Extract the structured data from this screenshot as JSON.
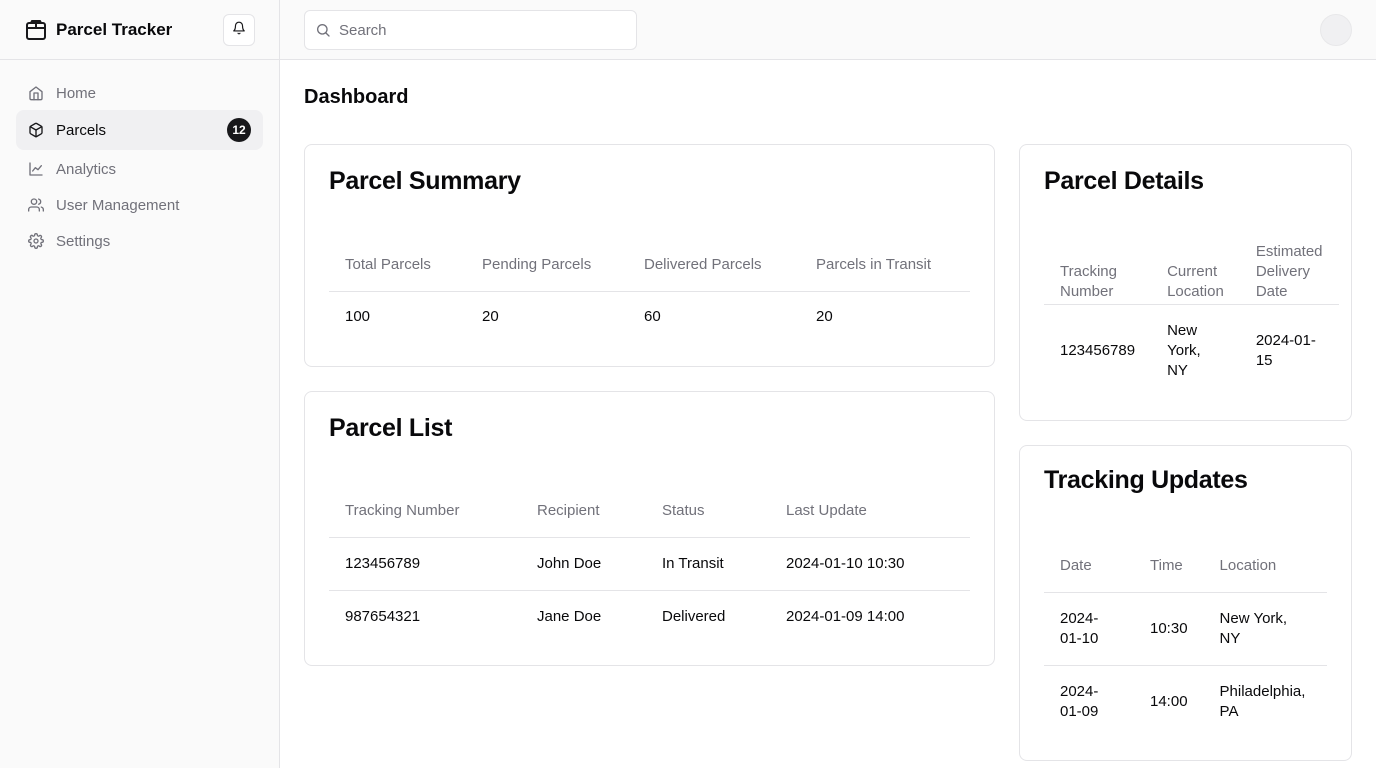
{
  "app": {
    "title": "Parcel Tracker"
  },
  "sidebar": {
    "items": [
      {
        "label": "Home",
        "icon": "home-icon",
        "active": false
      },
      {
        "label": "Parcels",
        "icon": "package-icon",
        "active": true,
        "badge": "12"
      },
      {
        "label": "Analytics",
        "icon": "line-chart-icon",
        "active": false
      },
      {
        "label": "User Management",
        "icon": "users-icon",
        "active": false
      },
      {
        "label": "Settings",
        "icon": "gear-icon",
        "active": false
      }
    ]
  },
  "search": {
    "placeholder": "Search"
  },
  "page": {
    "title": "Dashboard"
  },
  "summary": {
    "title": "Parcel Summary",
    "headers": [
      "Total Parcels",
      "Pending Parcels",
      "Delivered Parcels",
      "Parcels in Transit"
    ],
    "row": [
      "100",
      "20",
      "60",
      "20"
    ]
  },
  "parcel_list": {
    "title": "Parcel List",
    "headers": [
      "Tracking Number",
      "Recipient",
      "Status",
      "Last Update"
    ],
    "rows": [
      [
        "123456789",
        "John Doe",
        "In Transit",
        "2024-01-10 10:30"
      ],
      [
        "987654321",
        "Jane Doe",
        "Delivered",
        "2024-01-09 14:00"
      ]
    ]
  },
  "details": {
    "title": "Parcel Details",
    "headers": [
      "Tracking Number",
      "Current Location",
      "Estimated Delivery Date"
    ],
    "row": [
      "123456789",
      "New York, NY",
      "2024-01-15"
    ]
  },
  "updates": {
    "title": "Tracking Updates",
    "headers": [
      "Date",
      "Time",
      "Location"
    ],
    "rows": [
      [
        "2024-01-10",
        "10:30",
        "New York, NY"
      ],
      [
        "2024-01-09",
        "14:00",
        "Philadelphia, PA"
      ]
    ]
  },
  "colors": {
    "accent": "#18181b",
    "muted_text": "#71717a",
    "border": "#e4e4e7",
    "sidebar_bg": "#fafafa"
  }
}
